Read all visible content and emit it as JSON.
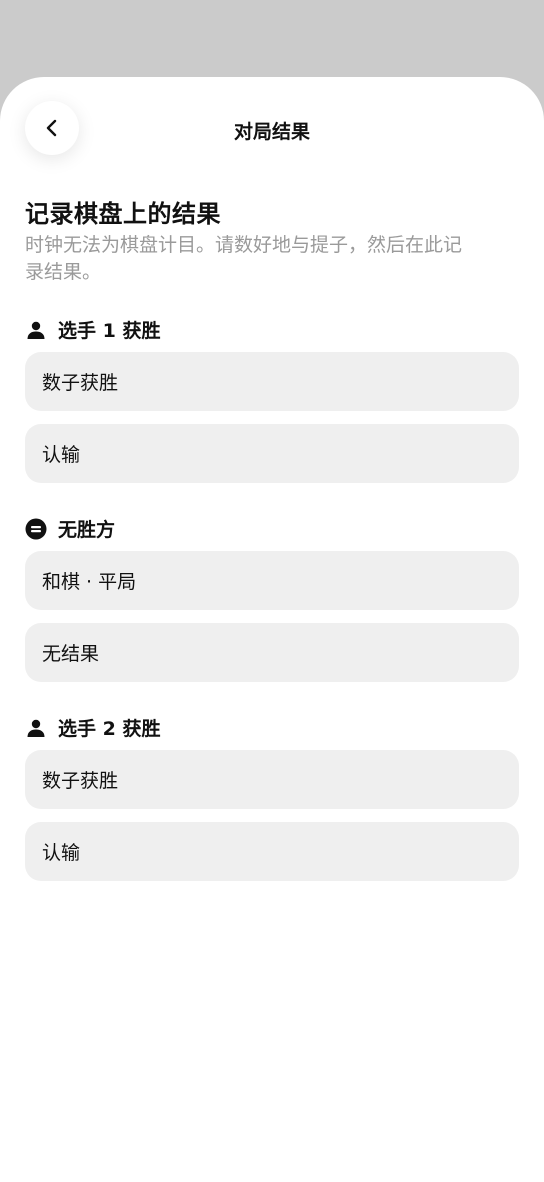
{
  "header": {
    "title": "对局结果",
    "back_icon": "chevron-left-icon"
  },
  "intro": {
    "heading": "记录棋盘上的结果",
    "subtitle": "时钟无法为棋盘计目。请数好地与提子，然后在此记录结果。"
  },
  "sections": [
    {
      "label": "选手 1 获胜",
      "icon": "person-icon",
      "options": [
        "数子获胜",
        "认输"
      ]
    },
    {
      "label": "无胜方",
      "icon": "equals-circle-icon",
      "options": [
        "和棋 · 平局",
        "无结果"
      ]
    },
    {
      "label": "选手 2 获胜",
      "icon": "person-icon",
      "options": [
        "数子获胜",
        "认输"
      ]
    }
  ],
  "colors": {
    "backdrop": "#cbcbcb",
    "sheet": "#ffffff",
    "option_bg": "#efefef",
    "subtitle_text": "#9a9a9a",
    "primary_text": "#111111"
  }
}
